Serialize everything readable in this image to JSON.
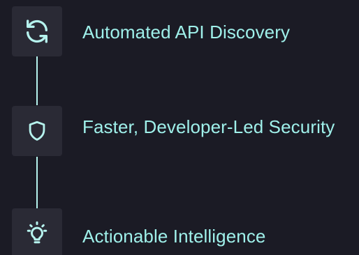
{
  "features": [
    {
      "icon": "refresh-icon",
      "label": "Automated API Discovery"
    },
    {
      "icon": "shield-icon",
      "label": "Faster, Developer-Led Security"
    },
    {
      "icon": "lightbulb-icon",
      "label": "Actionable Intelligence"
    }
  ],
  "colors": {
    "background": "#1b1b25",
    "icon_box": "#2a2a35",
    "accent": "#9ff0ea",
    "line": "#b6f3ee"
  }
}
